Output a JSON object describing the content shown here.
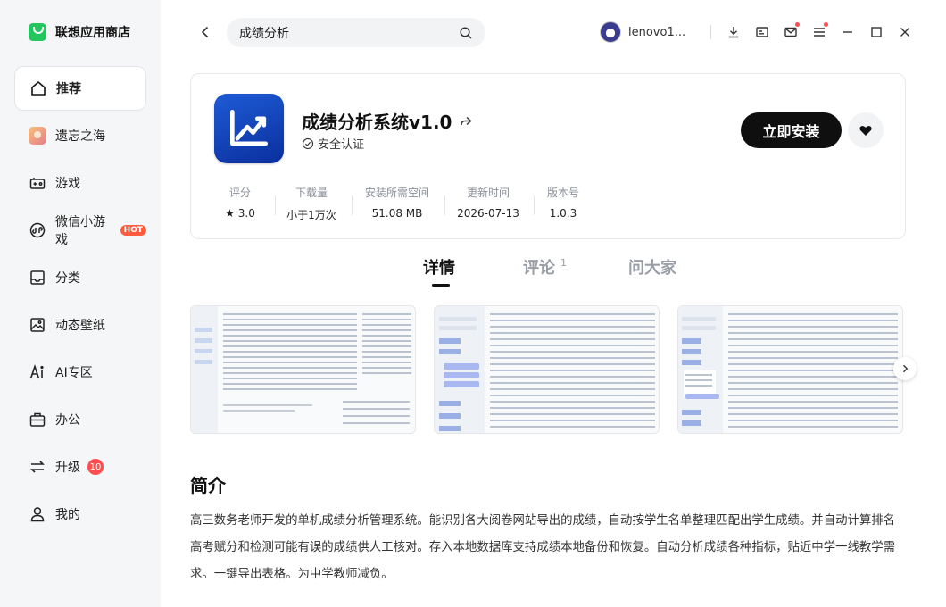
{
  "brand": {
    "name": "联想应用商店",
    "color": "#22c55e"
  },
  "sidebar": {
    "items": [
      {
        "label": "推荐",
        "icon": "home-icon",
        "active": true
      },
      {
        "label": "遗忘之海",
        "icon": "game-avatar-icon"
      },
      {
        "label": "游戏",
        "icon": "gamepad-icon"
      },
      {
        "label": "微信小游戏",
        "icon": "mini-game-icon",
        "badge": "HOT"
      },
      {
        "label": "分类",
        "icon": "category-icon"
      },
      {
        "label": "动态壁纸",
        "icon": "wallpaper-icon"
      },
      {
        "label": "AI专区",
        "icon": "ai-icon"
      },
      {
        "label": "办公",
        "icon": "briefcase-icon"
      },
      {
        "label": "升级",
        "icon": "update-icon",
        "badge": "10"
      },
      {
        "label": "我的",
        "icon": "user-icon"
      }
    ]
  },
  "search": {
    "value": "成绩分析"
  },
  "user": {
    "name": "lenovo1..."
  },
  "app": {
    "title": "成绩分析系统v1.0",
    "certification": "安全认证",
    "install_label": "立即安装",
    "stats": [
      {
        "label": "评分",
        "value": "★ 3.0"
      },
      {
        "label": "下载量",
        "value": "小于1万次"
      },
      {
        "label": "安装所需空间",
        "value": "51.08 MB"
      },
      {
        "label": "更新时间",
        "value": "2026-07-13"
      },
      {
        "label": "版本号",
        "value": "1.0.3"
      }
    ]
  },
  "tabs": [
    {
      "label": "详情",
      "active": true
    },
    {
      "label": "评论",
      "count": "1"
    },
    {
      "label": "问大家"
    }
  ],
  "intro": {
    "title": "简介",
    "text": "高三数务老师开发的单机成绩分析管理系统。能识别各大阅卷网站导出的成绩，自动按学生名单整理匹配出学生成绩。并自动计算排名高考赋分和检测可能有误的成绩供人工核对。存入本地数据库支持成绩本地备份和恢复。自动分析成绩各种指标，贴近中学一线教学需求。一键导出表格。为中学教师减负。"
  }
}
